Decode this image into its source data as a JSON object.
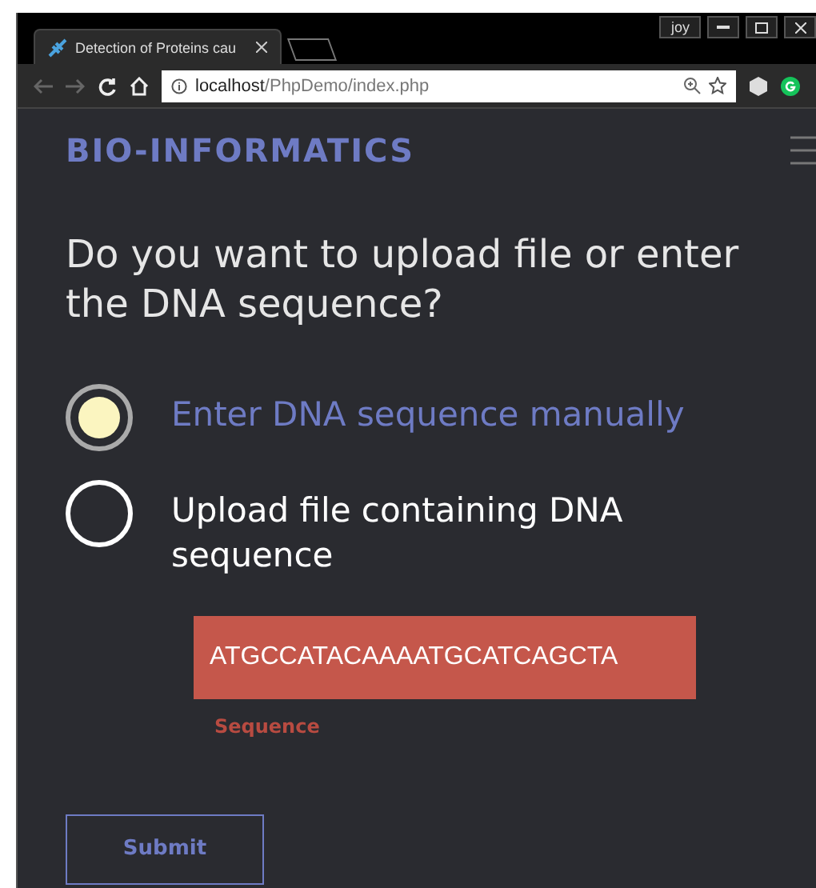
{
  "window": {
    "user": "joy"
  },
  "tabs": [
    {
      "title": "Detection of Proteins cau",
      "selected": true
    }
  ],
  "address_bar": {
    "host": "localhost",
    "path": "/PhpDemo/index.php"
  },
  "navbar": {
    "brand": "BIO-INFORMATICS"
  },
  "question": "Do you want to upload file or enter the DNA sequence?",
  "options": [
    {
      "label": "Enter DNA sequence manually",
      "selected": true
    },
    {
      "label": "Upload file containing DNA sequence",
      "selected": false
    }
  ],
  "sequence_field": {
    "value": "ATGCCATACAAAATGCATCAGCTA",
    "label": "Sequence"
  },
  "submit": "Submit"
}
